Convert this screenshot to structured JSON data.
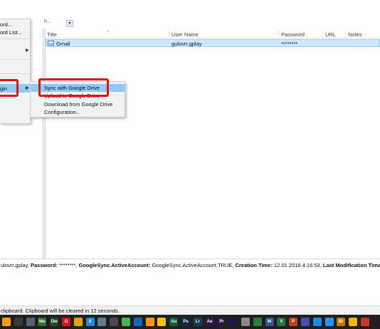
{
  "toolbar": {
    "search_tail": "h...",
    "dropdown_glyph": "▾"
  },
  "context_menu": {
    "items": [
      {
        "label": "ord...",
        "has_submenu": false
      },
      {
        "label": "ord List...",
        "has_submenu": false
      },
      {
        "label": "",
        "has_submenu": true
      },
      {
        "label": "gin",
        "has_submenu": true,
        "highlighted": true
      }
    ]
  },
  "submenu": {
    "items": [
      {
        "label": "Sync with Google Drive",
        "highlighted": true
      },
      {
        "label": "Upload to Google Drive",
        "highlighted": false
      },
      {
        "label": "Download from Google Drive",
        "highlighted": false
      },
      {
        "label": "Configuration...",
        "highlighted": false
      }
    ]
  },
  "table": {
    "columns": [
      "Title",
      "User Name",
      "Password",
      "URL",
      "Notes"
    ],
    "sort_glyph": "^",
    "rows": [
      {
        "title": "Gmail",
        "user_name": "gulovrr.gplay",
        "password": "********",
        "url": "",
        "notes": ""
      }
    ]
  },
  "detail": {
    "user_tail": "ulovrr.gplay, ",
    "password_label": "Password:",
    "password_value": " ********, ",
    "account_label": "GoogleSync.ActiveAccount:",
    "account_value": " GoogleSync.ActiveAccount.TRUE, ",
    "creation_label": "Creation Time:",
    "creation_value": " 12.01.2018 4:16:53, ",
    "modification_label": "Last Modification Time:"
  },
  "status": {
    "text": "clipboard. Clipboard will be cleared in 12 seconds."
  },
  "taskbar": {
    "icons": [
      {
        "name": "orange-app-icon",
        "label": "",
        "color": "#f39c12"
      },
      {
        "name": "file-explorer-icon",
        "label": "",
        "color": "#3a3a3a"
      },
      {
        "name": "steam-icon",
        "label": "",
        "color": "#556070"
      },
      {
        "name": "mu-icon",
        "label": "Mu",
        "color": "#2c6e2c"
      },
      {
        "name": "dreamweaver-icon",
        "label": "Dw",
        "color": "#1e4d1e"
      },
      {
        "name": "opera-icon",
        "label": "O",
        "color": "#d0131f"
      },
      {
        "name": "chrome-icon",
        "label": "",
        "color": "#e0a500"
      },
      {
        "name": "skype-icon",
        "label": "S",
        "color": "#1e88e5"
      },
      {
        "name": "app-icon",
        "label": "",
        "color": "#607d8b"
      },
      {
        "name": "camera-icon",
        "label": "",
        "color": "#4a4a4a"
      },
      {
        "name": "green-app-icon",
        "label": "",
        "color": "#4caf50"
      },
      {
        "name": "blue-app-icon",
        "label": "",
        "color": "#1565c0"
      },
      {
        "name": "browser-icon",
        "label": "",
        "color": "#ff9800"
      },
      {
        "name": "warning-icon",
        "label": "",
        "color": "#ffc107"
      },
      {
        "name": "audition-icon",
        "label": "Au",
        "color": "#0b5f3a"
      },
      {
        "name": "photoshop-icon",
        "label": "Ps",
        "color": "#0d2b4a"
      },
      {
        "name": "lightroom-icon",
        "label": "Lr",
        "color": "#1b3a56"
      },
      {
        "name": "after-effects-icon",
        "label": "Ae",
        "color": "#2a1a52"
      },
      {
        "name": "premiere-icon",
        "label": "Pr",
        "color": "#2b1647"
      },
      {
        "name": "media-encoder-icon",
        "label": "",
        "color": "#1a1a4a"
      },
      {
        "name": "image-viewer-icon",
        "label": "",
        "color": "#888888"
      },
      {
        "name": "keepass-icon",
        "label": "",
        "color": "#2e7d32"
      },
      {
        "name": "word-icon",
        "label": "W",
        "color": "#2b579a"
      },
      {
        "name": "excel-icon",
        "label": "X",
        "color": "#217346"
      },
      {
        "name": "powerpoint-icon",
        "label": "P",
        "color": "#c43e1c"
      },
      {
        "name": "globe-icon",
        "label": "",
        "color": "#3f51b5"
      },
      {
        "name": "sync-icon",
        "label": "",
        "color": "#1e88e5"
      },
      {
        "name": "settings-icon",
        "label": "",
        "color": "#2196f3"
      },
      {
        "name": "bridge-icon",
        "label": "Br",
        "color": "#c47a00"
      },
      {
        "name": "folder-icon",
        "label": "",
        "color": "#f4b400"
      },
      {
        "name": "red-app-icon",
        "label": "",
        "color": "#d32f2f"
      }
    ]
  },
  "colors": {
    "annotation_red": "#e31414",
    "selection_blue": "#cce8ff",
    "menu_highlight": "#91c9f7"
  }
}
